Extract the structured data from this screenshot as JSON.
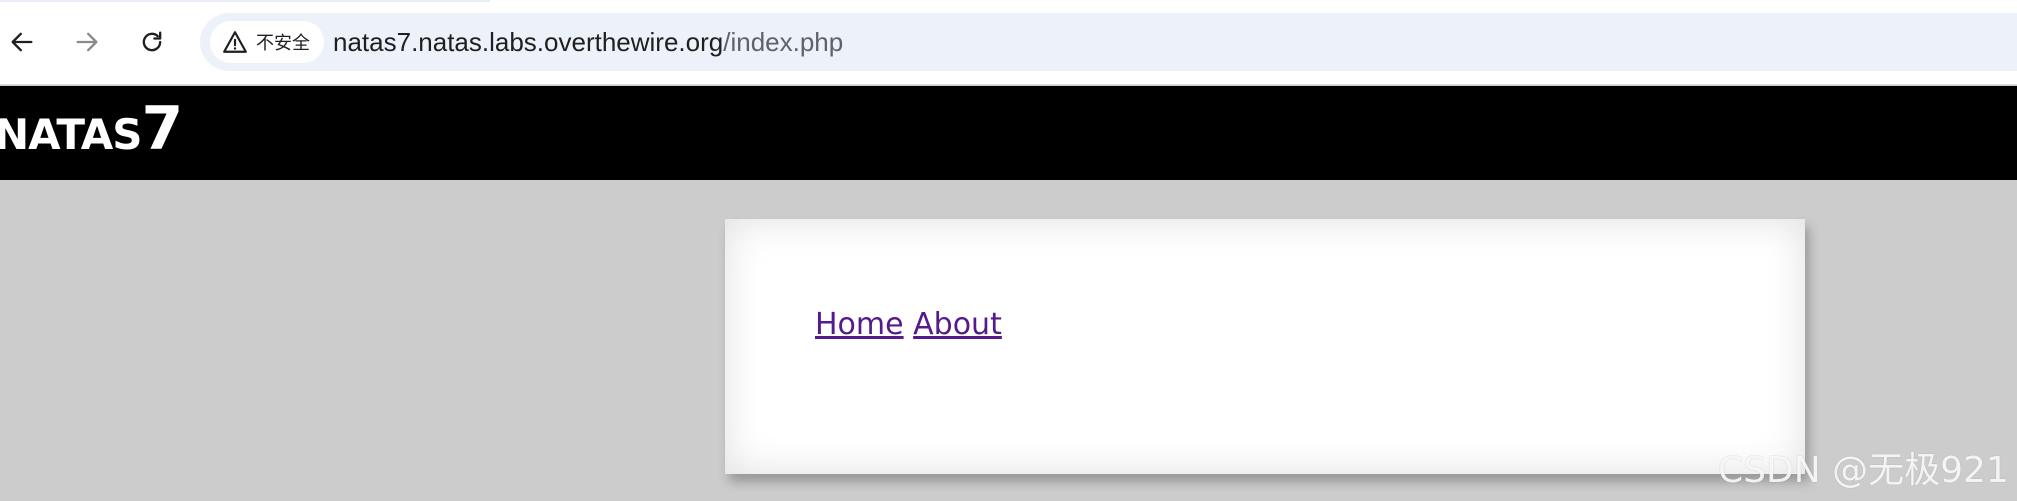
{
  "browser": {
    "security_label": "不安全",
    "url_host": "natas7.natas.labs.overthewire.org",
    "url_path": "/index.php"
  },
  "header": {
    "title_text": "NATAS",
    "title_number": "7"
  },
  "content": {
    "links": [
      {
        "label": "Home"
      },
      {
        "label": "About"
      }
    ]
  },
  "watermark": "CSDN @无极921"
}
